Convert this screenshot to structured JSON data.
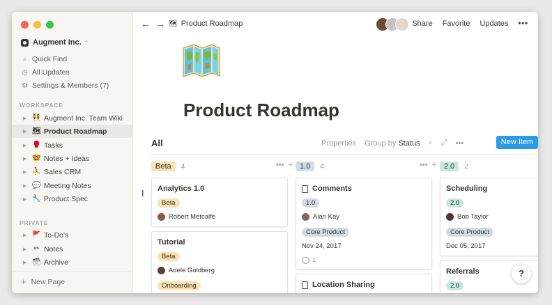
{
  "sidebar": {
    "workspace_name": "Augment Inc.",
    "workspace_chevron": "⌃",
    "nav": [
      {
        "icon": "search-icon",
        "glyph": "⌕",
        "label": "Quick Find"
      },
      {
        "icon": "clock-icon",
        "glyph": "◷",
        "label": "All Updates"
      },
      {
        "icon": "gear-icon",
        "glyph": "⚙",
        "label": "Settings & Members (7)"
      }
    ],
    "workspace_label": "WORKSPACE",
    "workspace_pages": [
      {
        "emoji": "👯",
        "label": "Augment Inc. Team Wiki"
      },
      {
        "emoji": "🗺",
        "label": "Product Roadmap"
      },
      {
        "emoji": "🥊",
        "label": "Tasks"
      },
      {
        "emoji": "🤓",
        "label": "Notes + Ideas"
      },
      {
        "emoji": "⛹",
        "label": "Sales CRM"
      },
      {
        "emoji": "💬",
        "label": "Meeting Notes"
      },
      {
        "emoji": "🔧",
        "label": "Product Spec"
      }
    ],
    "private_label": "PRIVATE",
    "private_pages": [
      {
        "emoji": "🚩",
        "label": "To-Do's"
      },
      {
        "emoji": "✏",
        "label": "Notes"
      },
      {
        "emoji": "🗃",
        "label": "Archive"
      }
    ],
    "new_page_label": "New Page"
  },
  "topbar": {
    "back_glyph": "←",
    "forward_glyph": "→",
    "crumb_emoji": "🗺",
    "crumb_title": "Product Roadmap",
    "share": "Share",
    "favorite": "Favorite",
    "updates": "Updates",
    "more": "•••"
  },
  "page": {
    "title": "Product Roadmap"
  },
  "view": {
    "name": "All",
    "properties": "Properties",
    "group_by_prefix": "Group by",
    "group_by_value": "Status",
    "new_item": "New Item"
  },
  "columns": [
    {
      "label": "Beta",
      "count": "4",
      "color": "#fbe3b1"
    },
    {
      "label": "1.0",
      "count": "4",
      "color": "#d3dbe5"
    },
    {
      "label": "2.0",
      "count": "2",
      "color": "#c7e8e2"
    }
  ],
  "cards": {
    "c1": {
      "title": "Analytics 1.0",
      "tag": "Beta",
      "person": "Robert Metcalfe"
    },
    "c2": {
      "title": "Tutorial",
      "tag": "Beta",
      "person": "Adele Goldberg",
      "tag2": "Onboarding"
    },
    "c3": {
      "title": "Comments",
      "tag": "1.0",
      "person": "Alan Kay",
      "tag2": "Core Product",
      "date": "Nov 24, 2017",
      "comments": "1"
    },
    "c4": {
      "title": "Location Sharing"
    },
    "c5": {
      "title": "Scheduling",
      "tag": "2.0",
      "person": "Bob Taylor",
      "tag2": "Core Product",
      "date": "Dec 05, 2017"
    },
    "c6": {
      "title": "Referrals",
      "tag": "2.0"
    }
  },
  "colors": {
    "beta": "#fbe3b1",
    "v1": "#d3dbe5",
    "v2": "#c7e8e2",
    "core_product": "#d3dbe5",
    "onboarding": "#fbe3b1",
    "accent": "#2e9ae5"
  },
  "help": "?"
}
